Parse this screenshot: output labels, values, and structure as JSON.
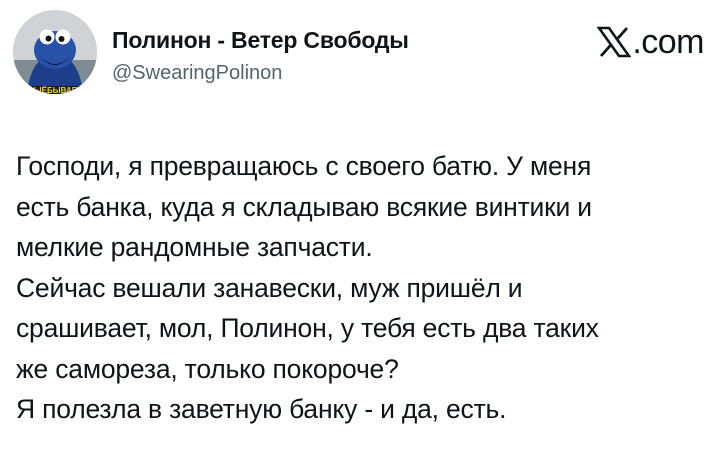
{
  "author": {
    "display_name": "Полинон - Ветер Свободы",
    "handle": "@SwearingPolinon",
    "avatar_badge": "ВЫЁБЫВАЕТ",
    "avatar_icon": "cookie-monster-avatar"
  },
  "brand": {
    "icon": "x-logo-icon",
    "suffix": ".com"
  },
  "tweet": {
    "lines": [
      "Господи, я превращаюсь с своего батю. У меня",
      "есть банка, куда я складываю всякие винтики и",
      "мелкие рандомные запчасти.",
      "Сейчас вешали занавески, муж пришёл и",
      "срашивает, мол, Полинон, у тебя есть два таких",
      "же самореза, только покороче?",
      "Я полезла в заветную банку - и да, есть."
    ]
  },
  "colors": {
    "text": "#0f1419",
    "secondary": "#536471",
    "background": "#ffffff"
  }
}
